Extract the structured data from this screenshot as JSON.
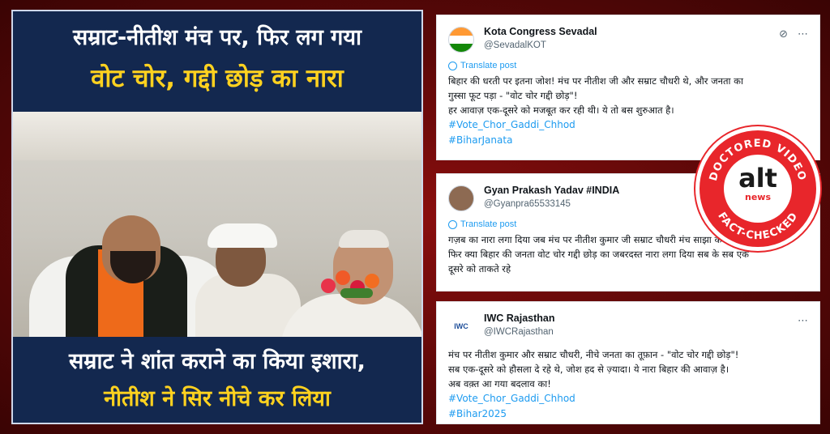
{
  "graphic": {
    "headline_line1": "सम्राट-नीतीश मंच पर, फिर लग गया",
    "headline_line2": "वोट चोर, गद्दी छोड़ का नारा",
    "banner_line1": "सम्राट ने शांत कराने का किया इशारा,",
    "banner_line2": "नीतीश ने सिर नीचे कर लिया"
  },
  "tweets": [
    {
      "name": "Kota Congress Sevadal",
      "handle": "@SevadalKOT",
      "translate": "Translate post",
      "lines": [
        "बिहार की धरती पर इतना जोश! मंच पर नीतीश जी और सम्राट चौधरी थे, और जनता का",
        "गुस्सा फूट पड़ा - \"वोट चोर गद्दी छोड़\"!",
        "हर आवाज़ एक-दूसरे को मजबूत कर रही थी। ये तो बस शुरुआत है।"
      ],
      "hashtags": [
        "#Vote_Chor_Gaddi_Chhod",
        "#BiharJanata"
      ]
    },
    {
      "name": "Gyan Prakash Yadav #INDIA",
      "handle": "@Gyanpra65533145",
      "translate": "Translate post",
      "lines": [
        "गज़ब का नारा लगा दिया जब मंच पर नीतीश कुमार जी सम्राट चौधरी मंच साझा कर रहे थे",
        "फिर क्या बिहार की जनता वोट चोर गद्दी छोड़ का जबरदस्त नारा लगा दिया सब के सब एक",
        "दूसरे को ताकते रहे"
      ],
      "hashtags": []
    },
    {
      "name": "IWC Rajasthan",
      "handle": "@IWCRajasthan",
      "avatar_text": "IWC",
      "lines": [
        "मंच पर नीतीश कुमार और सम्राट चौधरी, नीचे जनता का तूफ़ान - \"वोट चोर गद्दी छोड़\"!",
        "सब एक-दूसरे को हौसला दे रहे थे, जोश हद से ज़्यादा। ये नारा बिहार की आवाज़ है।",
        "अब वक़्त आ गया बदलाव का!"
      ],
      "hashtags": [
        "#Vote_Chor_Gaddi_Chhod",
        "#Bihar2025"
      ]
    }
  ],
  "stamp": {
    "top_text": "DOCTORED VIDEO",
    "bottom_text": "FACT-CHECKED",
    "logo": "alt",
    "logo_sub": "news"
  },
  "icons": {
    "grok": "grok-icon",
    "more": "more-icon",
    "globe": "globe-icon"
  },
  "colors": {
    "background": "#6e0a0a",
    "headline_yellow": "#ffd21f",
    "panel_navy": "#13284f",
    "link_blue": "#1d9bf0",
    "stamp_red": "#e8262b"
  }
}
